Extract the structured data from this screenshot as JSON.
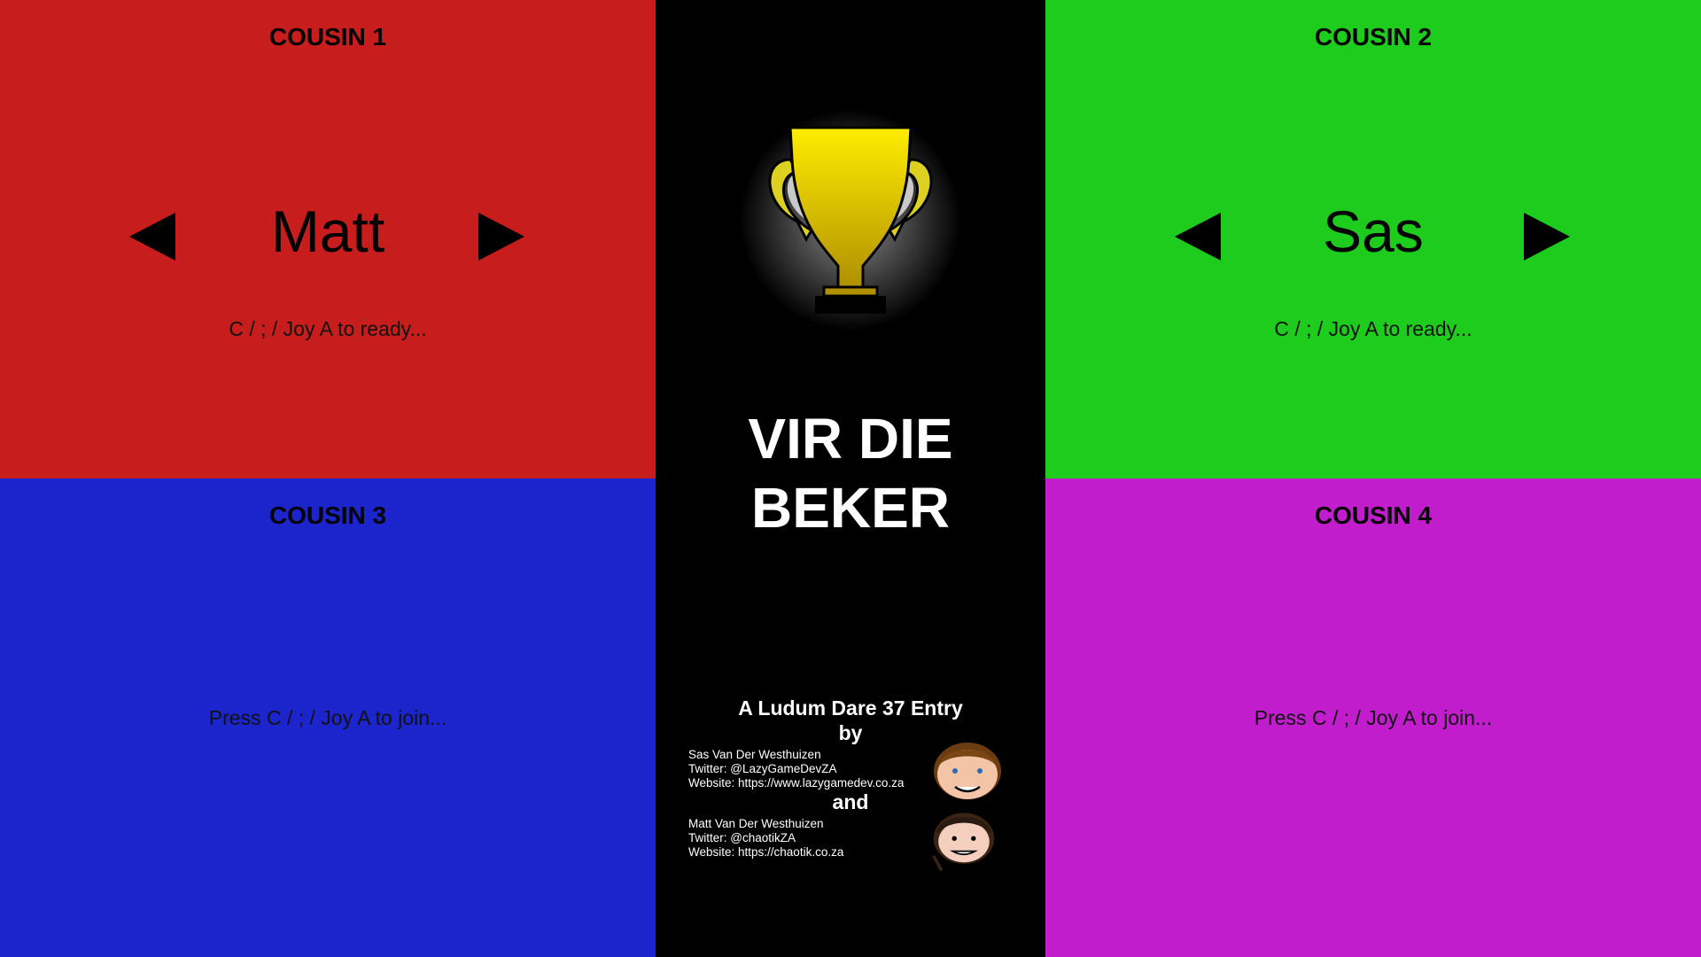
{
  "players": [
    {
      "title": "COUSIN 1",
      "name": "Matt",
      "hint": "C / ; / Joy A to ready...",
      "color": "#c81d1d"
    },
    {
      "title": "COUSIN 2",
      "name": "Sas",
      "hint": "C / ; / Joy A to ready...",
      "color": "#1dcc1d"
    },
    {
      "title": "COUSIN 3",
      "join": "Press C / ; / Joy A to join...",
      "color": "#1c25cc"
    },
    {
      "title": "COUSIN 4",
      "join": "Press C / ; / Joy A to join...",
      "color": "#c21dcc"
    }
  ],
  "center": {
    "title_line1": "VIR DIE",
    "title_line2": "BEKER",
    "entry": "A Ludum Dare 37 Entry",
    "by": "by",
    "and": "and",
    "author1": {
      "name": "Sas Van Der Westhuizen",
      "twitter": "Twitter: @LazyGameDevZA",
      "website": "Website: https://www.lazygamedev.co.za"
    },
    "author2": {
      "name": "Matt Van Der Westhuizen",
      "twitter": "Twitter: @chaotikZA",
      "website": "Website: https://chaotik.co.za"
    }
  },
  "icons": {
    "trophy": "trophy-icon",
    "arrow_left": "arrow-left-icon",
    "arrow_right": "arrow-right-icon"
  }
}
